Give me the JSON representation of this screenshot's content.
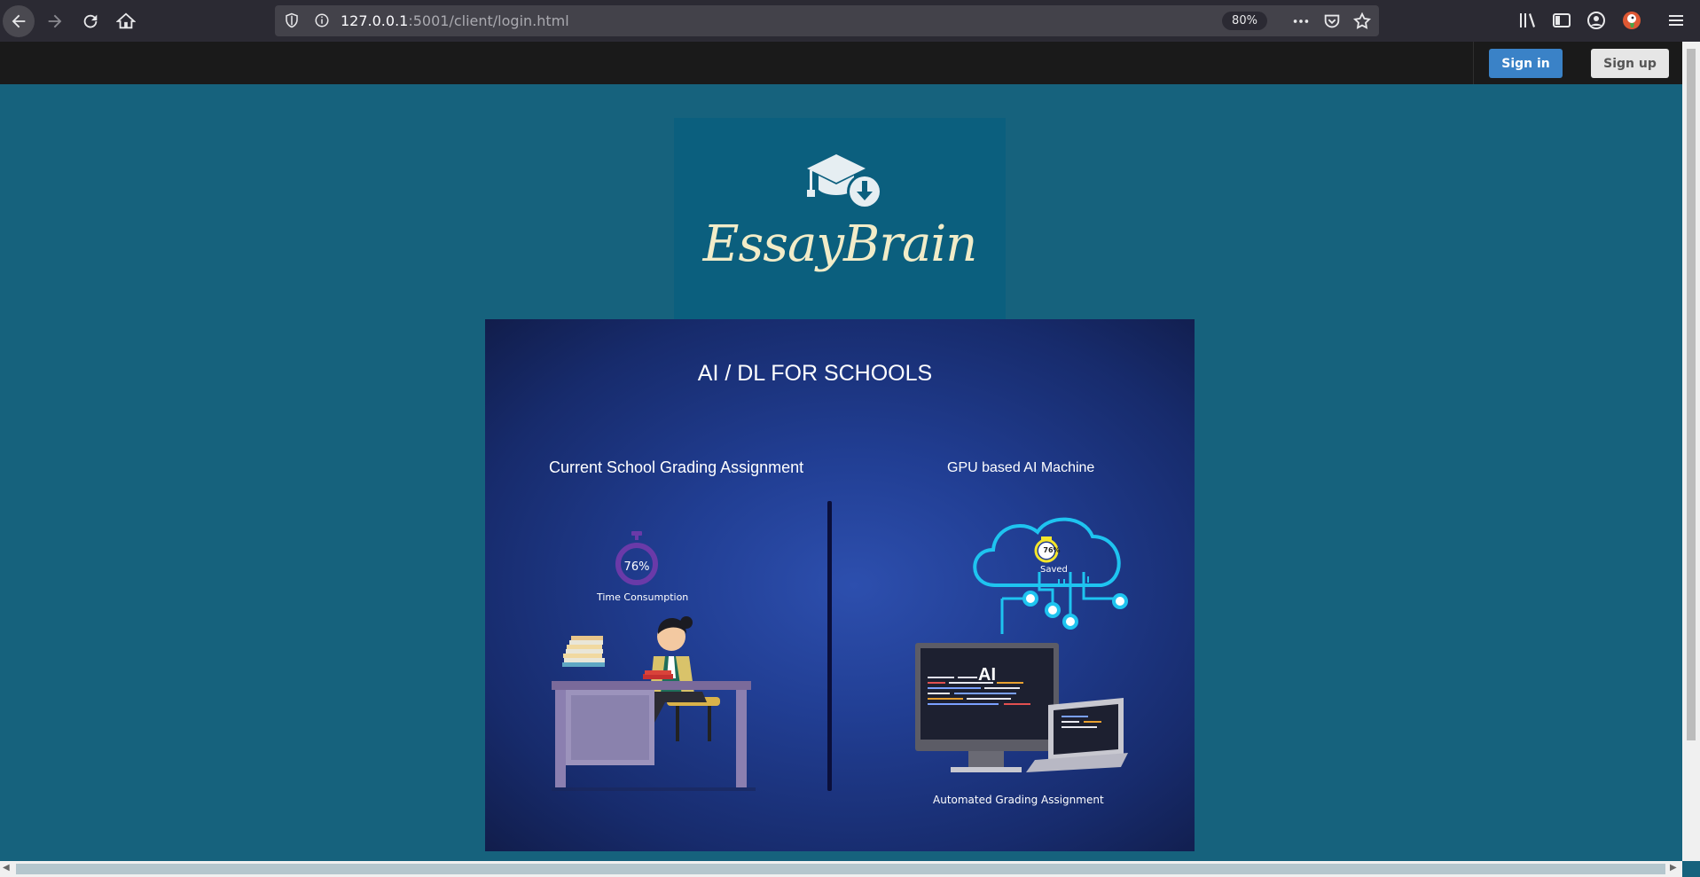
{
  "browser": {
    "url_host": "127.0.0.1",
    "url_rest": ":5001/client/login.html",
    "zoom": "80%",
    "icons": [
      "back-icon",
      "forward-icon",
      "reload-icon",
      "home-icon",
      "shield-icon",
      "info-icon",
      "more-icon",
      "pocket-icon",
      "bookmark-star-icon",
      "library-icon",
      "sidebar-icon",
      "account-icon",
      "duckduckgo-icon",
      "menu-icon"
    ]
  },
  "nav": {
    "signin": "Sign in",
    "signup": "Sign up",
    "signin_color": "#3a82c7"
  },
  "logo": {
    "text": "EssayBrain",
    "text_color": "#f2ecc8",
    "box_color": "#0b5f7e"
  },
  "banner": {
    "title": "AI / DL FOR SCHOOLS",
    "left_heading": "Current School Grading Assignment",
    "right_heading": "GPU based AI Machine",
    "left_timer_value": "76%",
    "left_timer_label": "Time Consumption",
    "right_timer_value": "76%",
    "right_timer_label": "Saved",
    "ai_label": "AI",
    "bottom_label": "Automated Grading Assignment"
  },
  "colors": {
    "page_bg": "#16627d",
    "accent_cyan": "#1ec4f0",
    "timer_purple": "#6a3aa8",
    "timer_yellow": "#f5e62a"
  }
}
